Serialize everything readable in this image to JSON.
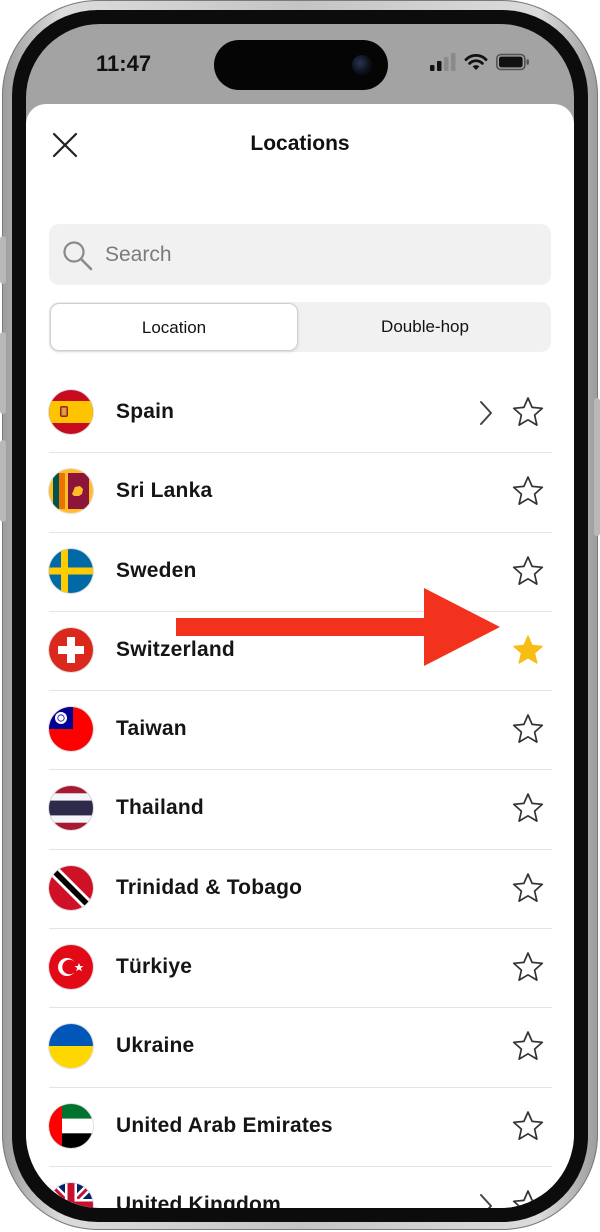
{
  "status_bar": {
    "time": "11:47"
  },
  "header": {
    "title": "Locations"
  },
  "search": {
    "placeholder": "Search",
    "value": ""
  },
  "tabs": [
    {
      "label": "Location",
      "selected": true
    },
    {
      "label": "Double-hop",
      "selected": false
    }
  ],
  "locations": [
    {
      "name": "Spain",
      "flag": "spain-flag-icon",
      "has_submenu": true,
      "favorite": false
    },
    {
      "name": "Sri Lanka",
      "flag": "sri-lanka-flag-icon",
      "has_submenu": false,
      "favorite": false
    },
    {
      "name": "Sweden",
      "flag": "sweden-flag-icon",
      "has_submenu": false,
      "favorite": false
    },
    {
      "name": "Switzerland",
      "flag": "switzerland-flag-icon",
      "has_submenu": false,
      "favorite": true
    },
    {
      "name": "Taiwan",
      "flag": "taiwan-flag-icon",
      "has_submenu": false,
      "favorite": false
    },
    {
      "name": "Thailand",
      "flag": "thailand-flag-icon",
      "has_submenu": false,
      "favorite": false
    },
    {
      "name": "Trinidad & Tobago",
      "flag": "trinidad-tobago-flag-icon",
      "has_submenu": false,
      "favorite": false
    },
    {
      "name": "Türkiye",
      "flag": "turkiye-flag-icon",
      "has_submenu": false,
      "favorite": false
    },
    {
      "name": "Ukraine",
      "flag": "ukraine-flag-icon",
      "has_submenu": false,
      "favorite": false
    },
    {
      "name": "United Arab Emirates",
      "flag": "uae-flag-icon",
      "has_submenu": false,
      "favorite": false
    },
    {
      "name": "United Kingdom",
      "flag": "uk-flag-icon",
      "has_submenu": true,
      "favorite": false
    }
  ],
  "colors": {
    "favorite_star": "#f7bd14",
    "annotation_arrow": "#f2321c",
    "segment_bg": "#f1f1f1"
  },
  "icons": [
    "close-icon",
    "search-icon",
    "chevron-right-icon",
    "star-outline-icon",
    "star-filled-icon"
  ]
}
